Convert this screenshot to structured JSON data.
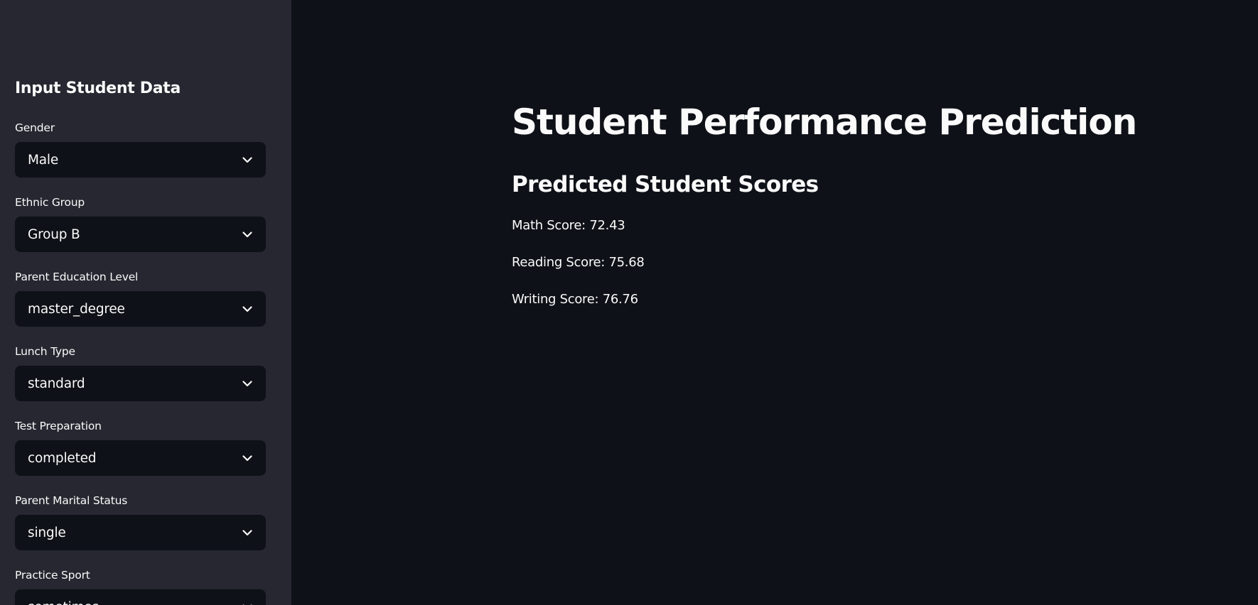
{
  "sidebar": {
    "title": "Input Student Data",
    "fields": [
      {
        "label": "Gender",
        "value": "Male"
      },
      {
        "label": "Ethnic Group",
        "value": "Group B"
      },
      {
        "label": "Parent Education Level",
        "value": "master_degree"
      },
      {
        "label": "Lunch Type",
        "value": "standard"
      },
      {
        "label": "Test Preparation",
        "value": "completed"
      },
      {
        "label": "Parent Marital Status",
        "value": "single"
      },
      {
        "label": "Practice Sport",
        "value": "sometimes"
      }
    ]
  },
  "main": {
    "title": "Student Performance Prediction",
    "subtitle": "Predicted Student Scores",
    "scores": [
      "Math Score: 72.43",
      "Reading Score: 75.68",
      "Writing Score: 76.76"
    ]
  },
  "colors": {
    "background": "#0e1117",
    "sidebar": "#262730",
    "text": "#fafafa"
  },
  "icons": {
    "select_chevron": "chevron-down-icon"
  }
}
